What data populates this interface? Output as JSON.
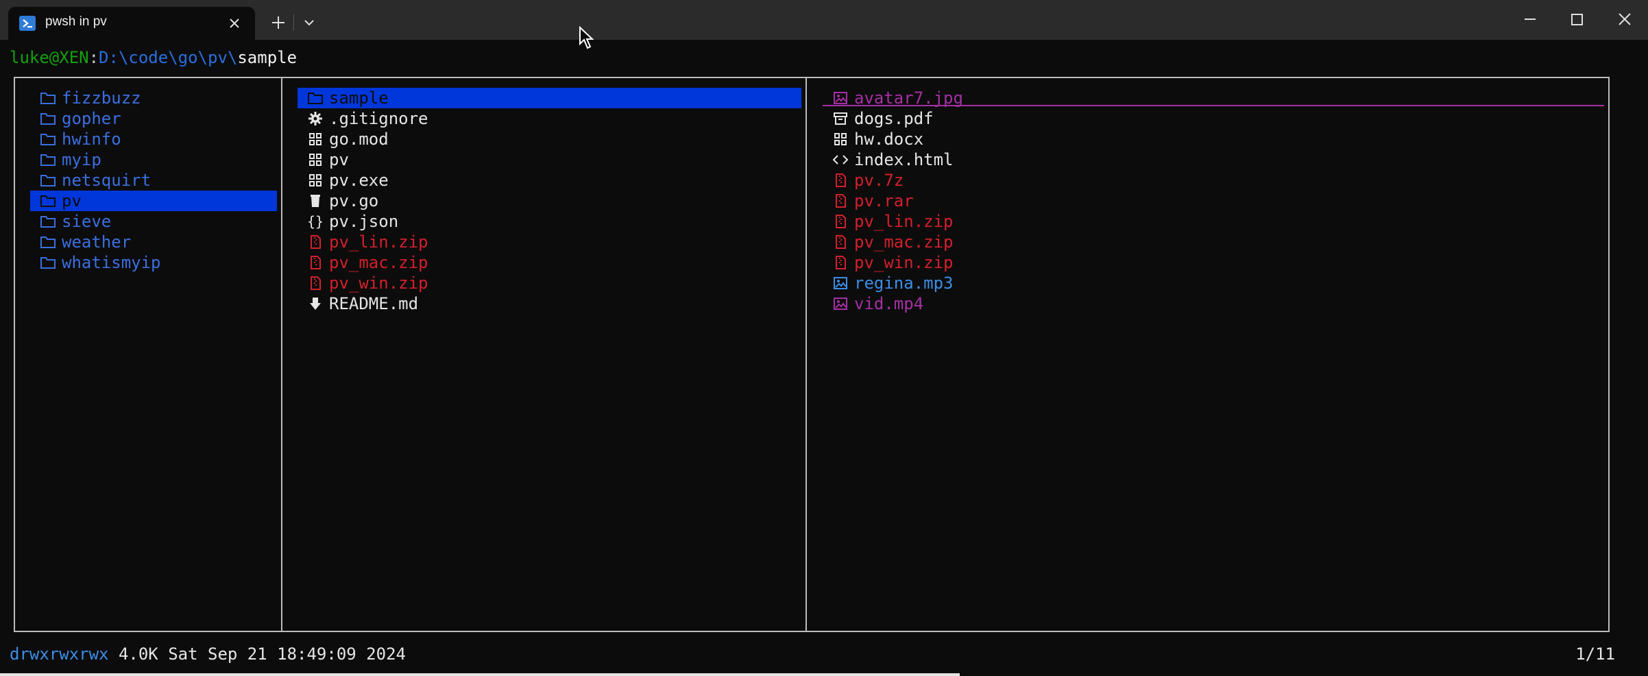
{
  "window": {
    "tab_title": "pwsh in pv",
    "tab_icon": "powershell-icon",
    "accent": "#2f7bd8"
  },
  "prompt": {
    "user_host": "luke@XEN",
    "colon": ":",
    "path": "D:\\code\\go\\pv\\",
    "current": "sample"
  },
  "left_panel": {
    "items": [
      {
        "name": "fizzbuzz",
        "icon": "folder-icon"
      },
      {
        "name": "gopher",
        "icon": "folder-icon"
      },
      {
        "name": "hwinfo",
        "icon": "folder-icon"
      },
      {
        "name": "myip",
        "icon": "folder-icon"
      },
      {
        "name": "netsquirt",
        "icon": "folder-icon"
      },
      {
        "name": "pv",
        "icon": "folder-icon",
        "selected": true
      },
      {
        "name": "sieve",
        "icon": "folder-icon"
      },
      {
        "name": "weather",
        "icon": "folder-icon"
      },
      {
        "name": "whatismyip",
        "icon": "folder-icon"
      }
    ]
  },
  "middle_panel": {
    "items": [
      {
        "name": "sample",
        "icon": "folder-icon",
        "selected": true
      },
      {
        "name": ".gitignore",
        "icon": "gear-icon"
      },
      {
        "name": "go.mod",
        "icon": "grid-icon"
      },
      {
        "name": "pv",
        "icon": "grid-icon"
      },
      {
        "name": "pv.exe",
        "icon": "grid-icon"
      },
      {
        "name": "pv.go",
        "icon": "gopher-icon"
      },
      {
        "name": "pv.json",
        "icon": "braces-icon"
      },
      {
        "name": "pv_lin.zip",
        "icon": "archive-icon"
      },
      {
        "name": "pv_mac.zip",
        "icon": "archive-icon"
      },
      {
        "name": "pv_win.zip",
        "icon": "archive-icon"
      },
      {
        "name": "README.md",
        "icon": "markdown-icon"
      }
    ]
  },
  "right_panel": {
    "items": [
      {
        "name": "avatar7.jpg",
        "icon": "image-icon"
      },
      {
        "name": "dogs.pdf",
        "icon": "document-icon"
      },
      {
        "name": "hw.docx",
        "icon": "grid-icon"
      },
      {
        "name": "index.html",
        "icon": "code-icon"
      },
      {
        "name": "pv.7z",
        "icon": "archive-icon"
      },
      {
        "name": "pv.rar",
        "icon": "archive-icon"
      },
      {
        "name": "pv_lin.zip",
        "icon": "archive-icon"
      },
      {
        "name": "pv_mac.zip",
        "icon": "archive-icon"
      },
      {
        "name": "pv_win.zip",
        "icon": "archive-icon"
      },
      {
        "name": "regina.mp3",
        "icon": "image-icon"
      },
      {
        "name": "vid.mp4",
        "icon": "image-icon"
      }
    ]
  },
  "status": {
    "permissions": "drwxrwxrwx",
    "details": " 4.0K Sat Sep 21 18:49:09 2024",
    "position": "1/11"
  },
  "colors": {
    "directory": "#3b6fe0",
    "selection": "#0037da",
    "archive": "#d3202c",
    "media": "#a530a5",
    "audio": "#3b8ee6",
    "prompt_user": "#13a10e"
  }
}
